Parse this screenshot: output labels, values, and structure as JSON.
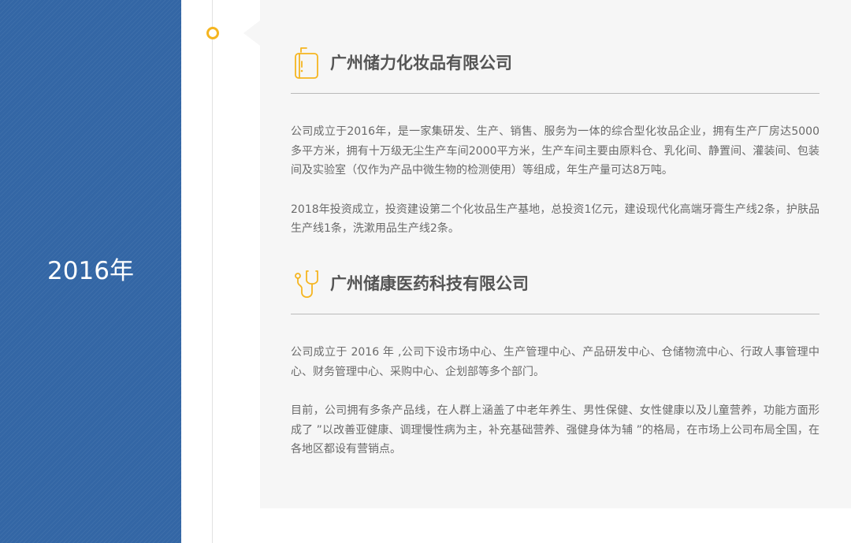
{
  "year_panel": {
    "year": "2016年"
  },
  "colors": {
    "year_panel_bg": "#3366a5",
    "accent": "#f5b520",
    "card_bg": "#f6f6f6"
  },
  "companies": [
    {
      "icon": "luggage-icon",
      "name": "广州储力化妆品有限公司",
      "paragraphs": [
        "公司成立于2016年，是一家集研发、生产、销售、服务为一体的综合型化妆品企业，拥有生产厂房达5000多平方米，拥有十万级无尘生产车间2000平方米，生产车间主要由原料仓、乳化间、静置间、灌装间、包装间及实验室（仅作为产品中微生物的检测使用）等组成，年生产量可达8万吨。",
        "2018年投资成立，投资建设第二个化妆品生产基地，总投资1亿元，建设现代化高端牙膏生产线2条，护肤品生产线1条，洗漱用品生产线2条。"
      ]
    },
    {
      "icon": "stethoscope-icon",
      "name": "广州储康医药科技有限公司",
      "paragraphs": [
        "公司成立于 2016 年 ,公司下设市场中心、生产管理中心、产品研发中心、仓储物流中心、行政人事管理中心、财务管理中心、采购中心、企划部等多个部门。",
        "目前，公司拥有多条产品线，在人群上涵盖了中老年养生、男性保健、女性健康以及儿童营养，功能方面形成了 ”以改善亚健康、调理慢性病为主，补充基础营养、强健身体为辅 ”的格局，在市场上公司布局全国，在各地区都设有营销点。"
      ]
    }
  ]
}
